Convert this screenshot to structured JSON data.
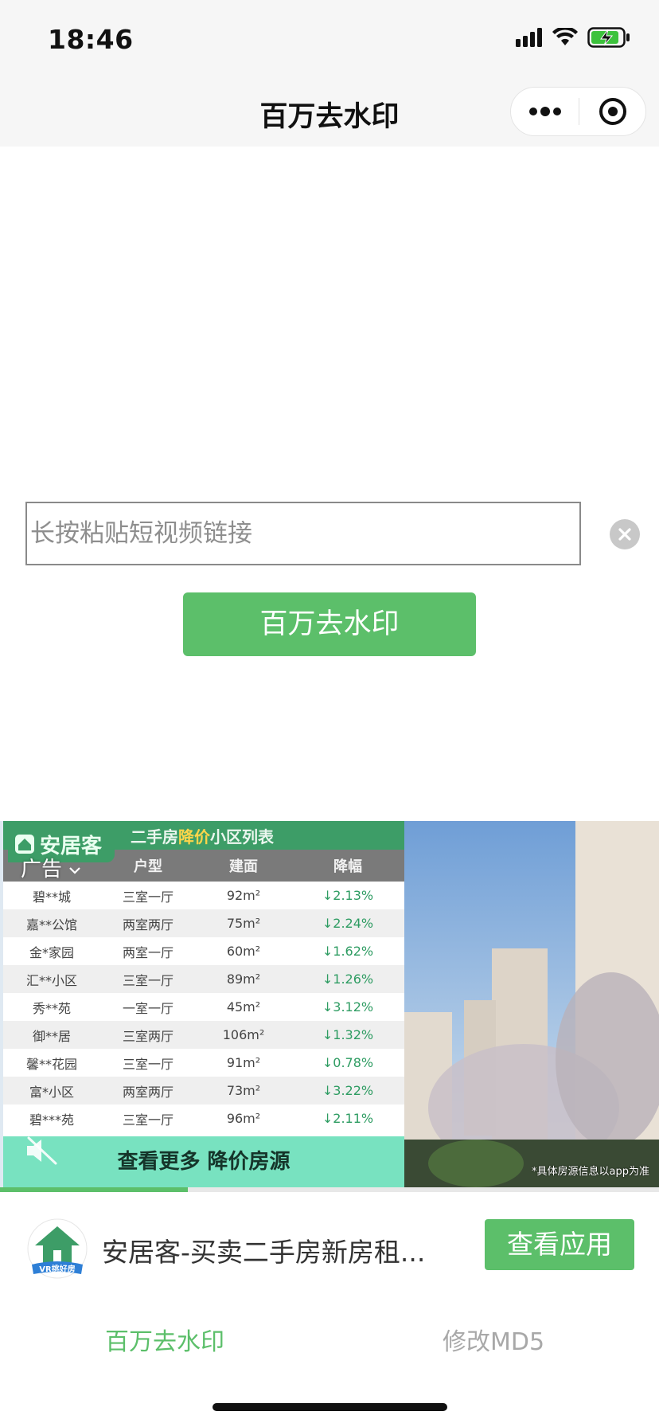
{
  "status_bar": {
    "time": "18:46",
    "colors": {
      "battery_charge": "#3cc23c"
    }
  },
  "nav": {
    "title": "百万去水印"
  },
  "main": {
    "input_placeholder": "长按粘贴短视频链接",
    "submit_label": "百万去水印"
  },
  "ad": {
    "label": "广告",
    "logo_text": "安居客",
    "table_title_prefix": "二手房",
    "table_title_highlight": "降价",
    "table_title_suffix": "小区列表",
    "columns": [
      "户型",
      "建面",
      "降幅"
    ],
    "rows": [
      [
        "碧**城",
        "三室一厅",
        "92m²",
        "↓2.13%"
      ],
      [
        "嘉**公馆",
        "两室两厅",
        "75m²",
        "↓2.24%"
      ],
      [
        "金*家园",
        "两室一厅",
        "60m²",
        "↓1.62%"
      ],
      [
        "汇**小区",
        "三室一厅",
        "89m²",
        "↓1.26%"
      ],
      [
        "秀**苑",
        "一室一厅",
        "45m²",
        "↓3.12%"
      ],
      [
        "御**居",
        "三室两厅",
        "106m²",
        "↓1.32%"
      ],
      [
        "馨**花园",
        "三室一厅",
        "91m²",
        "↓0.78%"
      ],
      [
        "富*小区",
        "两室两厅",
        "73m²",
        "↓3.22%"
      ],
      [
        "碧***苑",
        "三室一厅",
        "96m²",
        "↓2.11%"
      ]
    ],
    "cta_banner": "查看更多 降价房源",
    "disclaimer": "*具体房源信息以app为准",
    "progress": 0.285,
    "app_icon_caption": "VR挑好房",
    "app_name": "安居客-买卖二手房新房租...",
    "app_button": "查看应用"
  },
  "tabs": [
    {
      "label": "百万去水印",
      "active": true
    },
    {
      "label": "修改MD5",
      "active": false
    }
  ],
  "theme": {
    "accent": "#5cbf6a",
    "ad_green": "#3d9d67",
    "ad_cta": "#78e2c0"
  }
}
